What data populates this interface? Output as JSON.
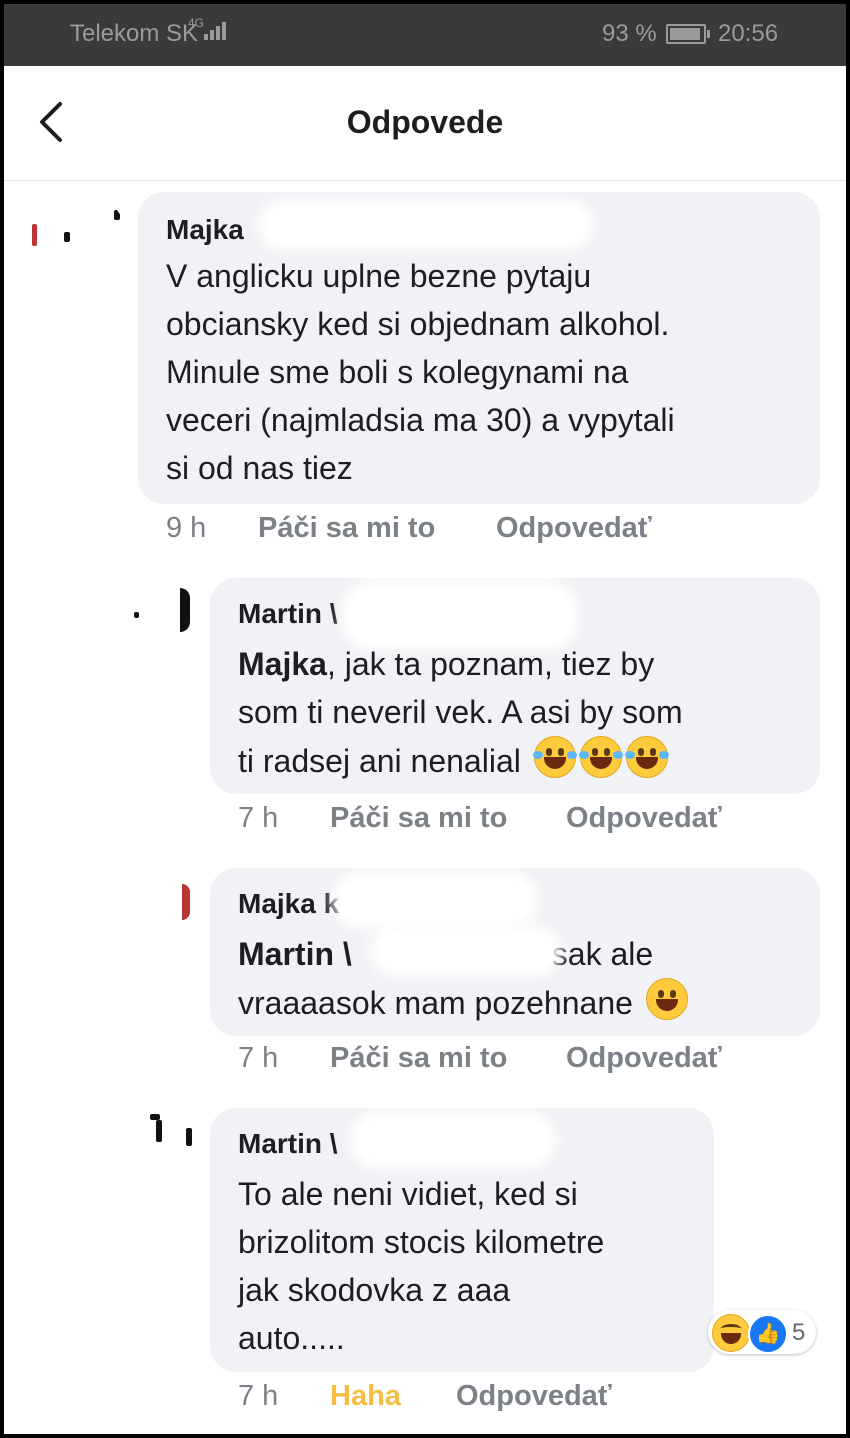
{
  "status_bar": {
    "carrier": "Telekom SK",
    "network": "4G",
    "battery": "93 %",
    "battery_level": 0.93,
    "time": "20:56"
  },
  "header": {
    "title": "Odpovede",
    "back_icon": "back-arrow-icon"
  },
  "comments": [
    {
      "name": "Majka",
      "lines": [
        "V anglicku uplne bezne pytaju",
        "obciansky ked si objednam alkohol.",
        "Minule sme boli s kolegynami na",
        "veceri (najmladsia ma 30) a vypytali",
        "si od nas tiez"
      ],
      "time": "9 h",
      "like": "Páči sa mi to",
      "reply": "Odpovedať"
    },
    {
      "name": "Martin \\",
      "mention": "Majka",
      "line1_rest": ", jak ta poznam, tiez by",
      "lines": [
        "som ti neveril vek. A asi by som",
        "ti radsej ani nenalial"
      ],
      "emoji": "tears-of-joy-emoji",
      "time": "7 h",
      "like": "Páči sa mi to",
      "reply": "Odpovedať"
    },
    {
      "name": "Majka k",
      "mention": "Martin \\",
      "line1_rest": "sak ale",
      "lines": [
        "vraaaasok mam pozehnane"
      ],
      "emoji": "grinning-emoji",
      "time": "7 h",
      "like": "Páči sa mi to",
      "reply": "Odpovedať"
    },
    {
      "name": "Martin \\",
      "lines": [
        "To ale neni vidiet, ked si",
        "brizolitom stocis kilometre",
        "jak skodovka z aaa",
        "auto....."
      ],
      "reactions": {
        "icons": [
          "haha-reaction-icon",
          "like-reaction-icon"
        ],
        "count": "5"
      },
      "time": "7 h",
      "reaction_label": "Haha",
      "reply": "Odpovedať",
      "reaction_color": "#f5bd41"
    }
  ]
}
